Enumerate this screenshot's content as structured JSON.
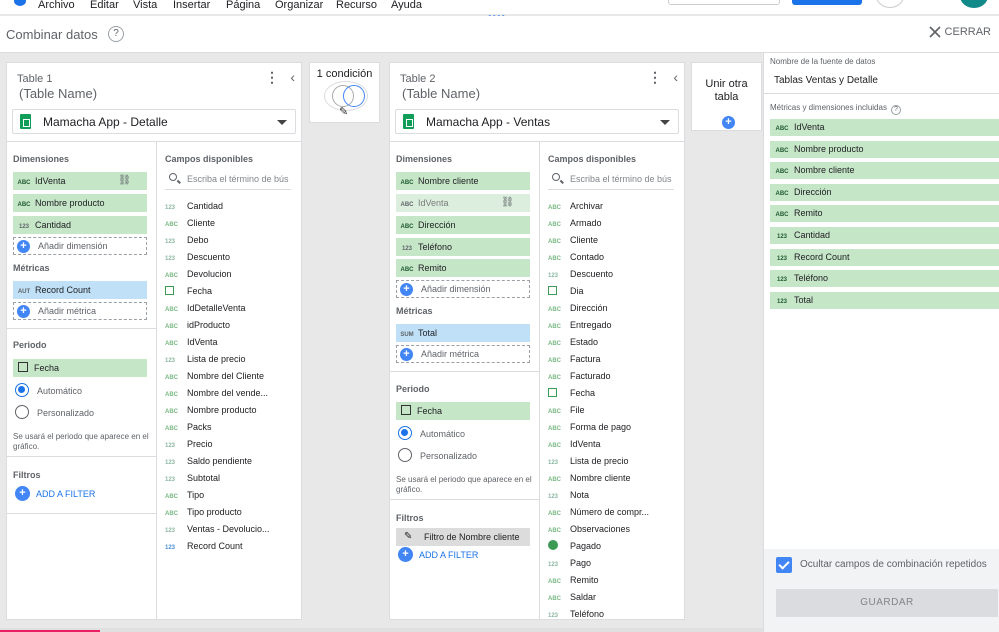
{
  "menu": [
    "Archivo",
    "Editar",
    "Vista",
    "Insertar",
    "Página",
    "Organizar",
    "Recurso",
    "Ayuda"
  ],
  "header": {
    "title": "Combinar datos",
    "close_label": "CERRAR"
  },
  "table1": {
    "label": "Table 1",
    "name": "(Table Name)",
    "source": "Mamacha App - Detalle",
    "dimensions_title": "Dimensiones",
    "dimensions": [
      {
        "badge": "ABC",
        "label": "IdVenta"
      },
      {
        "badge": "ABC",
        "label": "Nombre producto"
      },
      {
        "badge": "123",
        "label": "Cantidad"
      }
    ],
    "add_dimension": "Añadir dimensión",
    "metrics_title": "Métricas",
    "metrics": [
      {
        "badge": "AUT",
        "label": "Record Count"
      }
    ],
    "add_metric": "Añadir métrica",
    "period_title": "Periodo",
    "period_field": "Fecha",
    "radio_auto": "Automático",
    "radio_custom": "Personalizado",
    "note": "Se usará el periodo que aparece en el gráfico.",
    "filters_title": "Filtros",
    "add_filter": "ADD A FILTER",
    "available_title": "Campos disponibles",
    "search_placeholder": "Escriba el término de bús",
    "fields": [
      {
        "t": "123",
        "l": "Cantidad"
      },
      {
        "t": "ABC",
        "l": "Cliente"
      },
      {
        "t": "123",
        "l": "Debo"
      },
      {
        "t": "123",
        "l": "Descuento"
      },
      {
        "t": "ABC",
        "l": "Devolucion"
      },
      {
        "t": "CAL",
        "l": "Fecha"
      },
      {
        "t": "ABC",
        "l": "IdDetalleVenta"
      },
      {
        "t": "ABC",
        "l": "idProducto"
      },
      {
        "t": "ABC",
        "l": "IdVenta"
      },
      {
        "t": "123",
        "l": "Lista de precio"
      },
      {
        "t": "ABC",
        "l": "Nombre del Cliente"
      },
      {
        "t": "ABC",
        "l": "Nombre del vende..."
      },
      {
        "t": "ABC",
        "l": "Nombre producto"
      },
      {
        "t": "ABC",
        "l": "Packs"
      },
      {
        "t": "123",
        "l": "Precio"
      },
      {
        "t": "123",
        "l": "Saldo pendiente"
      },
      {
        "t": "123",
        "l": "Subtotal"
      },
      {
        "t": "ABC",
        "l": "Tipo"
      },
      {
        "t": "ABC",
        "l": "Tipo producto"
      },
      {
        "t": "123",
        "l": "Ventas - Devolucio..."
      },
      {
        "t": "123",
        "l": "Record Count"
      }
    ]
  },
  "condition": {
    "label": "1 condición"
  },
  "table2": {
    "label": "Table 2",
    "name": "(Table Name)",
    "source": "Mamacha App - Ventas",
    "dimensions_title": "Dimensiones",
    "dimensions": [
      {
        "badge": "ABC",
        "label": "Nombre cliente"
      },
      {
        "badge": "ABC",
        "label": "IdVenta"
      },
      {
        "badge": "ABC",
        "label": "Dirección"
      },
      {
        "badge": "123",
        "label": "Teléfono"
      },
      {
        "badge": "ABC",
        "label": "Remito"
      }
    ],
    "add_dimension": "Añadir dimensión",
    "metrics_title": "Métricas",
    "metrics": [
      {
        "badge": "SUM",
        "label": "Total"
      }
    ],
    "add_metric": "Añadir métrica",
    "period_title": "Periodo",
    "period_field": "Fecha",
    "radio_auto": "Automático",
    "radio_custom": "Personalizado",
    "note": "Se usará el periodo que aparece en el gráfico.",
    "filters_title": "Filtros",
    "filter_chip": "Filtro de Nombre cliente",
    "add_filter": "ADD A FILTER",
    "available_title": "Campos disponibles",
    "search_placeholder": "Escriba el término de bús",
    "fields": [
      {
        "t": "ABC",
        "l": "Archivar"
      },
      {
        "t": "ABC",
        "l": "Armado"
      },
      {
        "t": "ABC",
        "l": "Cliente"
      },
      {
        "t": "ABC",
        "l": "Contado"
      },
      {
        "t": "123",
        "l": "Descuento"
      },
      {
        "t": "CAL",
        "l": "Dia"
      },
      {
        "t": "ABC",
        "l": "Dirección"
      },
      {
        "t": "ABC",
        "l": "Entregado"
      },
      {
        "t": "ABC",
        "l": "Estado"
      },
      {
        "t": "ABC",
        "l": "Factura"
      },
      {
        "t": "ABC",
        "l": "Facturado"
      },
      {
        "t": "CAL",
        "l": "Fecha"
      },
      {
        "t": "ABC",
        "l": "File"
      },
      {
        "t": "ABC",
        "l": "Forma de pago"
      },
      {
        "t": "ABC",
        "l": "IdVenta"
      },
      {
        "t": "123",
        "l": "Lista de precio"
      },
      {
        "t": "ABC",
        "l": "Nombre cliente"
      },
      {
        "t": "123",
        "l": "Nota"
      },
      {
        "t": "ABC",
        "l": "Número de compr..."
      },
      {
        "t": "ABC",
        "l": "Observaciones"
      },
      {
        "t": "GLOBE",
        "l": "Pagado"
      },
      {
        "t": "123",
        "l": "Pago"
      },
      {
        "t": "ABC",
        "l": "Remito"
      },
      {
        "t": "ABC",
        "l": "Saldar"
      },
      {
        "t": "123",
        "l": "Teléfono"
      }
    ]
  },
  "join_table": {
    "label": "Unir otra tabla"
  },
  "right_panel": {
    "ds_label": "Nombre de la fuente de datos",
    "ds_name": "Tablas Ventas y Detalle",
    "included_label": "Métricas y dimensiones incluidas",
    "included": [
      {
        "badge": "ABC",
        "label": "IdVenta"
      },
      {
        "badge": "ABC",
        "label": "Nombre producto"
      },
      {
        "badge": "ABC",
        "label": "Nombre cliente"
      },
      {
        "badge": "ABC",
        "label": "Dirección"
      },
      {
        "badge": "ABC",
        "label": "Remito"
      },
      {
        "badge": "123",
        "label": "Cantidad"
      },
      {
        "badge": "123",
        "label": "Record Count"
      },
      {
        "badge": "123",
        "label": "Teléfono"
      },
      {
        "badge": "123",
        "label": "Total"
      }
    ],
    "hide_repeated": "Ocultar campos de combinación repetidos",
    "save_label": "GUARDAR"
  }
}
